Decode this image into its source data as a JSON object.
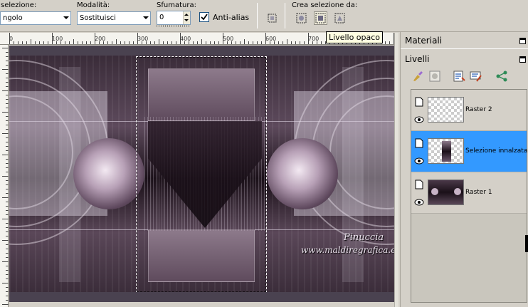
{
  "toolbar": {
    "selection_label": "selezione:",
    "selection_value": "ngolo",
    "mode_label": "Modalità:",
    "mode_value": "Sostituisci",
    "feather_label": "Sfumatura:",
    "feather_value": "0",
    "antialias_label": "Anti-alias",
    "antialias_checked": true,
    "create_from_label": "Crea selezione da:",
    "icons": [
      "selection-frame-icon",
      "from-layer-icon",
      "from-opaque-layer-icon",
      "from-mask-icon"
    ]
  },
  "tooltip": {
    "text": "Livello opaco"
  },
  "ruler": {
    "marks": [
      "0",
      "100",
      "200",
      "300",
      "400",
      "500",
      "600",
      "700"
    ]
  },
  "watermark": {
    "line1": "Pinuccia",
    "line2": "www.maldiregrafica.eu"
  },
  "panels": {
    "materials_title": "Materiali",
    "layers_title": "Livelli",
    "layer_tools": [
      "paintbrush-icon",
      "mask-icon",
      "properties-icon",
      "edit-icon",
      "share-icon"
    ]
  },
  "layers": [
    {
      "name": "Raster 2",
      "selected": false,
      "thumb": "transparent"
    },
    {
      "name": "Selezione innalzata",
      "selected": true,
      "thumb": "selection"
    },
    {
      "name": "Raster 1",
      "selected": false,
      "thumb": "image"
    }
  ],
  "colors": {
    "selected_layer": "#3399ff",
    "panel_bg": "#d4d0c8",
    "tooltip_bg": "#ffffe1"
  }
}
